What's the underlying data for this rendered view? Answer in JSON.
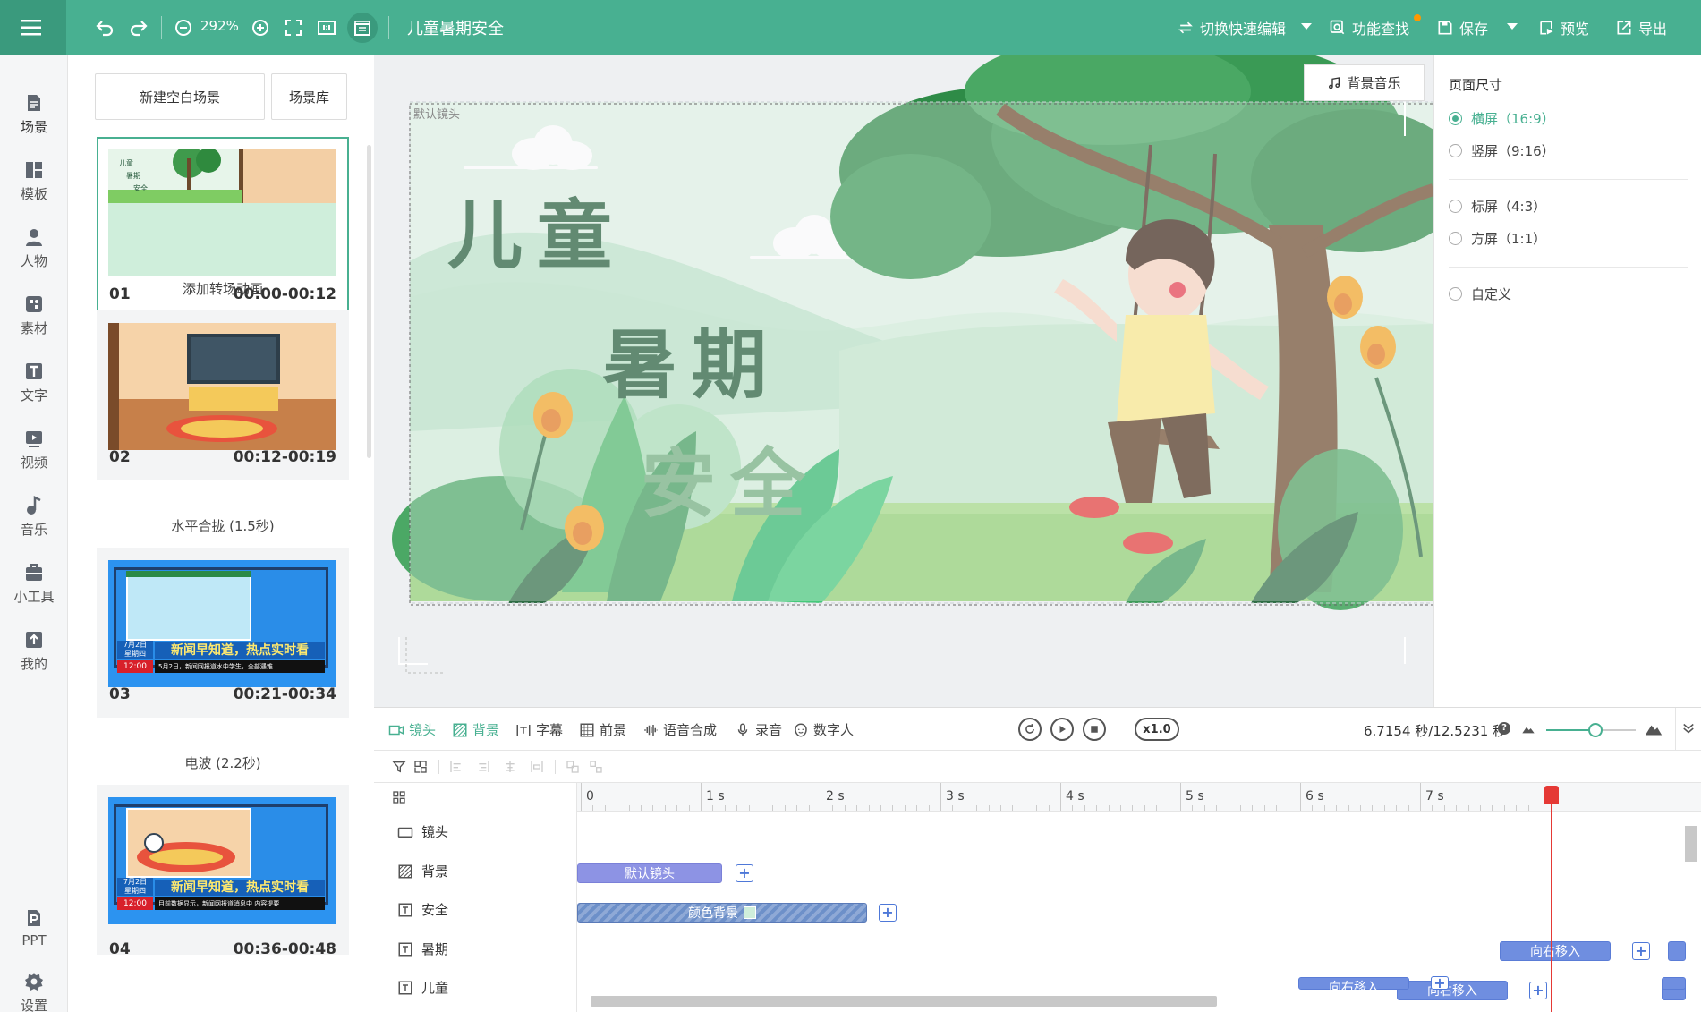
{
  "topbar": {
    "zoom": "292%",
    "title": "儿童暑期安全",
    "actions": {
      "quick_edit": "切换快速编辑",
      "find": "功能查找",
      "save": "保存",
      "preview": "预览",
      "export": "导出"
    }
  },
  "sidenav": [
    {
      "label": "场景",
      "icon": "scene-icon"
    },
    {
      "label": "模板",
      "icon": "template-icon"
    },
    {
      "label": "人物",
      "icon": "person-icon"
    },
    {
      "label": "素材",
      "icon": "material-icon"
    },
    {
      "label": "文字",
      "icon": "text-icon"
    },
    {
      "label": "视频",
      "icon": "video-icon"
    },
    {
      "label": "音乐",
      "icon": "music-icon"
    },
    {
      "label": "小工具",
      "icon": "toolbox-icon"
    },
    {
      "label": "我的",
      "icon": "upload-icon"
    },
    {
      "label": "PPT",
      "icon": "ppt-icon"
    },
    {
      "label": "设置",
      "icon": "gear-icon"
    }
  ],
  "scene_panel": {
    "new_scene": "新建空白场景",
    "library": "场景库",
    "scenes": [
      {
        "num": "01",
        "time": "00:00-00:12",
        "transition": "添加转场动画"
      },
      {
        "num": "02",
        "time": "00:12-00:19",
        "transition": "水平合拢 (1.5秒)"
      },
      {
        "num": "03",
        "time": "00:21-00:34",
        "transition": "电波 (2.2秒)"
      },
      {
        "num": "04",
        "time": "00:36-00:48"
      }
    ],
    "news_banner": "新闻早知道，热点实时看",
    "news_date": "7月2日",
    "news_weekday": "星期四",
    "news_clock": "12:00",
    "news_ticker_3": "5月2日，新闻网报道水中学生，全部遇难",
    "news_ticker_4": "目前数据显示，新闻网报道消息中 内容提要"
  },
  "canvas": {
    "music_button": "背景音乐",
    "camera_label": "默认镜头",
    "title_line1": "儿童",
    "title_line2": "暑期",
    "title_line3": "安全"
  },
  "properties": {
    "heading": "页面尺寸",
    "options": [
      {
        "label": "横屏（16:9）",
        "checked": true
      },
      {
        "label": "竖屏（9:16）",
        "checked": false
      },
      {
        "label": "标屏（4:3）",
        "checked": false
      },
      {
        "label": "方屏（1:1）",
        "checked": false
      },
      {
        "label": "自定义",
        "checked": false
      }
    ]
  },
  "timeline": {
    "tools": [
      {
        "label": "镜头",
        "icon": "camera-icon",
        "active": true
      },
      {
        "label": "背景",
        "icon": "background-icon",
        "active": true
      },
      {
        "label": "字幕",
        "icon": "subtitle-icon",
        "active": false
      },
      {
        "label": "前景",
        "icon": "foreground-icon",
        "active": false
      },
      {
        "label": "语音合成",
        "icon": "voice-wave-icon",
        "active": false
      },
      {
        "label": "录音",
        "icon": "mic-icon",
        "active": false
      },
      {
        "label": "数字人",
        "icon": "avatar-icon",
        "active": false
      }
    ],
    "speed": "x1.0",
    "time_readout": "6.7154 秒/12.5231 秒",
    "zoom_fraction": 0.55,
    "ruler": [
      "0",
      "1 s",
      "2 s",
      "3 s",
      "4 s",
      "5 s",
      "6 s",
      "7 s"
    ],
    "tracks": [
      {
        "name": "镜头",
        "icon": "camera-icon",
        "clip": "默认镜头"
      },
      {
        "name": "背景",
        "icon": "background-icon",
        "clip": "颜色背景"
      },
      {
        "name": "安全",
        "icon": "text-box-icon",
        "clip": "向右移入"
      },
      {
        "name": "暑期",
        "icon": "text-box-icon",
        "clip": "向右移入"
      },
      {
        "name": "儿童",
        "icon": "text-box-icon",
        "clip": "向右移入"
      }
    ],
    "playhead_seconds": 6.7154
  },
  "colors": {
    "brand": "#48b091",
    "clip": "#6f8ee0",
    "playhead": "#e53935"
  }
}
